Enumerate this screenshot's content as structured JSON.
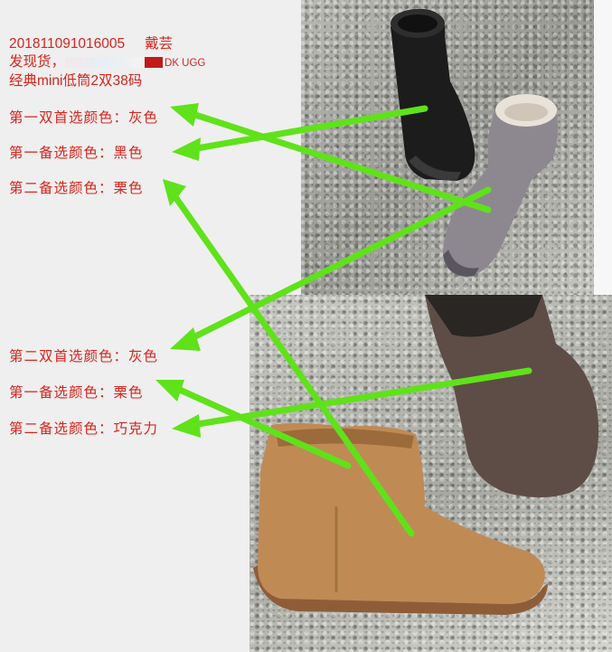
{
  "order": {
    "id": "201811091016005",
    "name": "戴芸",
    "ship_label": "发现货，",
    "brand": "DK UGG",
    "model": "经典mini低筒2双38码"
  },
  "pair1": {
    "first_choice": "第一双首选颜色：灰色",
    "backup1": "第一备选颜色：黑色",
    "backup2": "第二备选颜色：栗色"
  },
  "pair2": {
    "first_choice": "第二双首选颜色：灰色",
    "backup1": "第一备选颜色：栗色",
    "backup2": "第二备选颜色：巧克力"
  },
  "colors": {
    "text": "#d8251e",
    "arrow": "#5fe21a"
  }
}
